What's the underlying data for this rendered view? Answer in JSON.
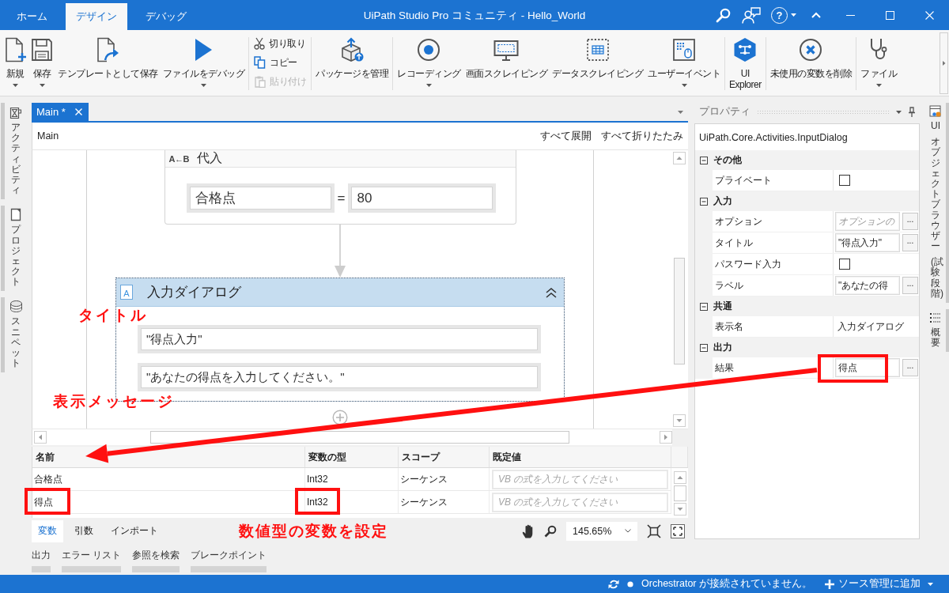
{
  "window": {
    "tabs": [
      {
        "label": "ホーム",
        "selected": false
      },
      {
        "label": "デザイン",
        "selected": true
      },
      {
        "label": "デバッグ",
        "selected": false
      }
    ],
    "title": "UiPath Studio Pro コミュニティ - Hello_World",
    "help_button": "?"
  },
  "ribbon": {
    "groups": [
      {
        "kind": "large",
        "buttons": [
          {
            "label": "新規",
            "dropdown": true
          },
          {
            "label": "保存",
            "dropdown": true
          },
          {
            "label": "テンプレートとして保存",
            "dropdown": false
          },
          {
            "label": "ファイルをデバッグ",
            "dropdown": true
          }
        ]
      },
      {
        "kind": "small",
        "buttons": [
          {
            "label": "切り取り",
            "disabled": false
          },
          {
            "label": "コピー",
            "disabled": false
          },
          {
            "label": "貼り付け",
            "disabled": true
          }
        ]
      },
      {
        "kind": "large",
        "buttons": [
          {
            "label": "パッケージを管理",
            "dropdown": false
          }
        ]
      },
      {
        "kind": "large",
        "buttons": [
          {
            "label": "レコーディング",
            "dropdown": true
          },
          {
            "label": "画面スクレイピング",
            "dropdown": false
          },
          {
            "label": "データスクレイピング",
            "dropdown": false
          },
          {
            "label": "ユーザーイベント",
            "dropdown": true
          }
        ]
      },
      {
        "kind": "large",
        "buttons": [
          {
            "label": "UI Explorer",
            "dropdown": false
          }
        ]
      },
      {
        "kind": "large",
        "buttons": [
          {
            "label": "未使用の変数を削除",
            "dropdown": false
          }
        ]
      },
      {
        "kind": "large",
        "buttons": [
          {
            "label": "ファイル",
            "dropdown": true
          }
        ]
      }
    ]
  },
  "side_tabs_left": [
    "アクティビティ",
    "プロジェクト",
    "スニペット"
  ],
  "document": {
    "tabs": [
      {
        "label": "Main *",
        "selected": true
      }
    ],
    "breadcrumb": "Main",
    "actions": [
      "すべて展開",
      "すべて折りたたみ"
    ],
    "activities": [
      {
        "kind": "assign",
        "symbol": "A←B",
        "title": "代入",
        "to": "合格点",
        "operator": "=",
        "value": "80"
      },
      {
        "kind": "input_dialog",
        "symbol": "A",
        "title": "入力ダイアログ",
        "selected": true,
        "expanded": true,
        "fields": [
          "\"得点入力\"",
          "\"あなたの得点を入力してください。\""
        ]
      }
    ]
  },
  "variables": {
    "columns": [
      "名前",
      "変数の型",
      "スコープ",
      "既定値"
    ],
    "rows": [
      {
        "name": "合格点",
        "type": "Int32",
        "scope": "シーケンス",
        "placeholder": "VB の式を入力してください",
        "highlighted": false
      },
      {
        "name": "得点",
        "type": "Int32",
        "scope": "シーケンス",
        "placeholder": "VB の式を入力してください",
        "highlighted": true
      }
    ]
  },
  "designer_tabs": [
    {
      "label": "変数",
      "selected": true
    },
    {
      "label": "引数",
      "selected": false
    },
    {
      "label": "インポート",
      "selected": false
    }
  ],
  "zoom": "145.65%",
  "panel_tabs": [
    "出力",
    "エラー リスト",
    "参照を検索",
    "ブレークポイント"
  ],
  "properties": {
    "title": "プロパティ",
    "type_name": "UiPath.Core.Activities.InputDialog",
    "categories": [
      {
        "name": "その他",
        "expanded": true,
        "properties": [
          {
            "label": "プライベート",
            "kind": "checkbox",
            "checked": false
          }
        ]
      },
      {
        "name": "入力",
        "expanded": true,
        "properties": [
          {
            "label": "オプション",
            "kind": "expression",
            "placeholder": "オプションの",
            "button": "...",
            "highlighted": false
          },
          {
            "label": "タイトル",
            "kind": "expression",
            "value": "\"得点入力\"",
            "button": "...",
            "highlighted": false
          },
          {
            "label": "パスワード入力",
            "kind": "checkbox",
            "checked": false
          },
          {
            "label": "ラベル",
            "kind": "expression",
            "value": "\"あなたの得",
            "button": "...",
            "highlighted": false
          }
        ]
      },
      {
        "name": "共通",
        "expanded": true,
        "properties": [
          {
            "label": "表示名",
            "kind": "text",
            "value": "入力ダイアログ"
          }
        ]
      },
      {
        "name": "出力",
        "expanded": true,
        "properties": [
          {
            "label": "結果",
            "kind": "expression",
            "value": "得点",
            "button": "...",
            "highlighted": true
          }
        ]
      }
    ]
  },
  "side_tabs_right": [
    "UI オブジェクトブラウザー (試験段階)",
    "概要"
  ],
  "annotations": [
    "タイトル",
    "表示メッセージ",
    "数値型の変数を設定"
  ],
  "status_bar": {
    "connection": "Orchestrator が接続されていません。",
    "source_control": "ソース管理に追加"
  }
}
